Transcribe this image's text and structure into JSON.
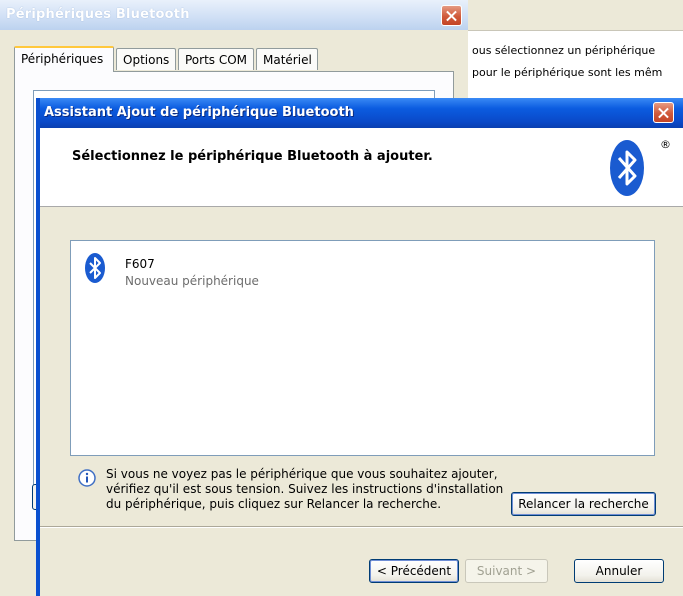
{
  "background": {
    "lines": [
      "ous sélectionnez un périphérique",
      "pour le périphérique sont les mêm"
    ]
  },
  "back_window": {
    "title": "Périphériques Bluetooth",
    "tabs": [
      "Périphériques",
      "Options",
      "Ports COM",
      "Matériel"
    ],
    "close_icon": "close-icon"
  },
  "dialog": {
    "title": "Assistant Ajout de périphérique Bluetooth",
    "header": "Sélectionnez le périphérique Bluetooth à ajouter.",
    "registered_mark": "®",
    "devices": [
      {
        "name": "F607",
        "status": "Nouveau périphérique",
        "icon": "bluetooth-icon"
      }
    ],
    "info_text": "Si vous ne voyez pas le périphérique que vous souhaitez ajouter, vérifiez qu'il est sous tension. Suivez les instructions d'installation du périphérique, puis cliquez sur Relancer la recherche.",
    "rescan_button": "Relancer la recherche",
    "back_button": "< Précédent",
    "next_button": "Suivant >",
    "cancel_button": "Annuler"
  },
  "colors": {
    "title_blue": "#0b5ce0",
    "bluetooth_blue": "#1a5bd0",
    "close_red": "#d05a3b",
    "window_face": "#ece9d8"
  }
}
